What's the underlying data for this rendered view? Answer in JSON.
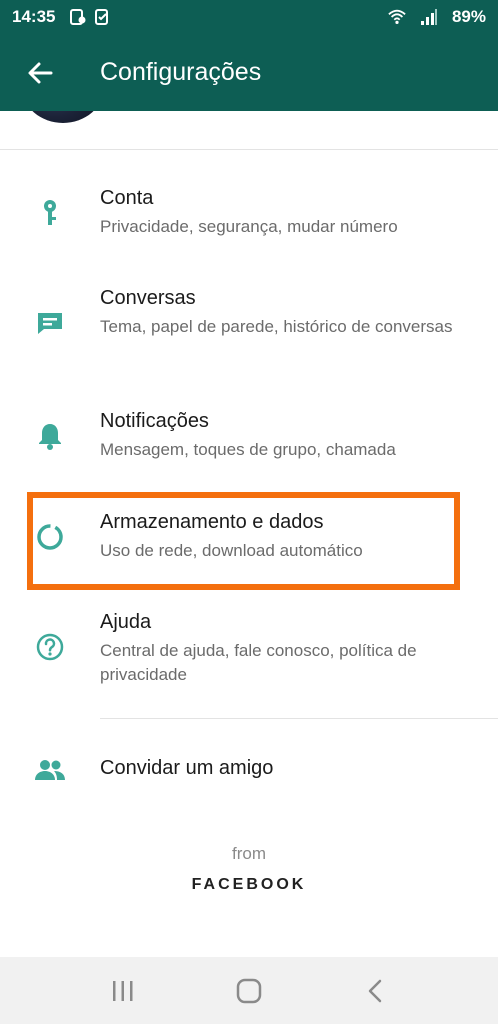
{
  "status": {
    "time": "14:35",
    "battery": "89%"
  },
  "appbar": {
    "title": "Configurações"
  },
  "settings": [
    {
      "label": "Conta",
      "sub": "Privacidade, segurança, mudar número",
      "icon": "key-icon"
    },
    {
      "label": "Conversas",
      "sub": "Tema, papel de parede, histórico de conversas",
      "icon": "chat-icon"
    },
    {
      "label": "Notificações",
      "sub": "Mensagem, toques de grupo, chamada",
      "icon": "bell-icon"
    },
    {
      "label": "Armazenamento e dados",
      "sub": "Uso de rede, download automático",
      "icon": "data-usage-icon"
    },
    {
      "label": "Ajuda",
      "sub": "Central de ajuda, fale conosco, política de privacidade",
      "icon": "help-icon"
    }
  ],
  "invite": {
    "label": "Convidar um amigo",
    "icon": "people-icon"
  },
  "footer": {
    "from": "from",
    "brand": "FACEBOOK"
  },
  "colors": {
    "header": "#0d5e54",
    "icon": "#3ea99a",
    "highlight": "#f46f0e"
  }
}
